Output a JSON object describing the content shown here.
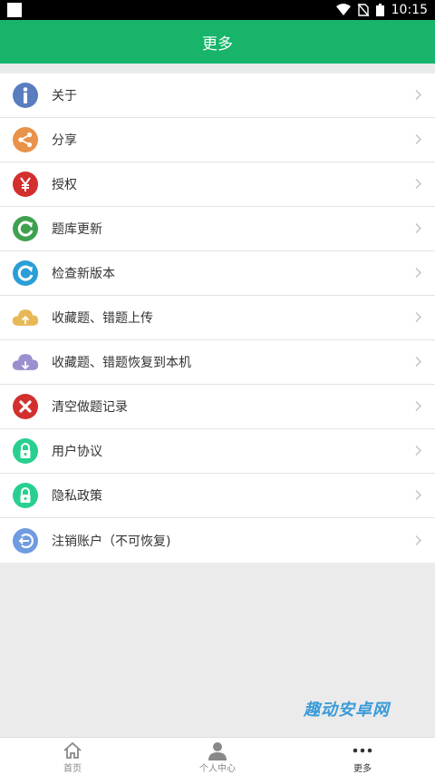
{
  "status_bar": {
    "time": "10:15"
  },
  "header": {
    "title": "更多"
  },
  "menu": {
    "items": [
      {
        "label": "关于",
        "icon": "info-icon",
        "color": "#5a7dbf"
      },
      {
        "label": "分享",
        "icon": "share-icon",
        "color": "#e8924a"
      },
      {
        "label": "授权",
        "icon": "yen-icon",
        "color": "#d32f2f"
      },
      {
        "label": "题库更新",
        "icon": "refresh-icon",
        "color": "#3fa14e"
      },
      {
        "label": "检查新版本",
        "icon": "refresh-icon",
        "color": "#2a9fd6"
      },
      {
        "label": "收藏题、错题上传",
        "icon": "cloud-upload-icon",
        "color": "#e8b857"
      },
      {
        "label": "收藏题、错题恢复到本机",
        "icon": "cloud-download-icon",
        "color": "#9c8fcf"
      },
      {
        "label": "清空做题记录",
        "icon": "clear-icon",
        "color": "#d32f2f"
      },
      {
        "label": "用户协议",
        "icon": "lock-icon",
        "color": "#28d08f"
      },
      {
        "label": "隐私政策",
        "icon": "lock-icon",
        "color": "#28d08f"
      },
      {
        "label": "注销账户（不可恢复)",
        "icon": "logout-icon",
        "color": "#6f9be0"
      }
    ]
  },
  "watermark": "趣动安卓网",
  "bottom_nav": {
    "tabs": [
      {
        "label": "首页",
        "icon": "home-icon"
      },
      {
        "label": "个人中心",
        "icon": "person-icon"
      },
      {
        "label": "更多",
        "icon": "more-icon"
      }
    ]
  }
}
